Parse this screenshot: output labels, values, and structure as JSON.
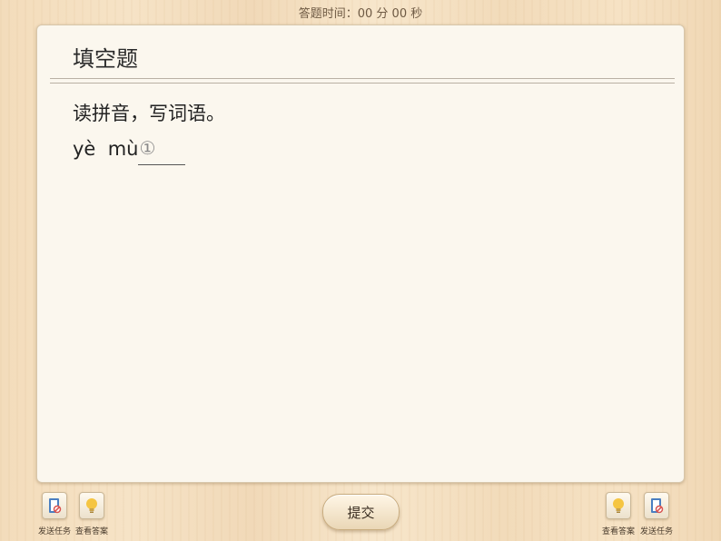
{
  "timer": {
    "text": "答题时间：00 分 00 秒"
  },
  "question": {
    "type_title": "填空题",
    "instruction": "读拼音，写词语。",
    "pinyin": "yè  mù",
    "blank_number": "①"
  },
  "toolbar": {
    "left": [
      {
        "label": "发送任务",
        "icon": "send-task-icon"
      },
      {
        "label": "查看答案",
        "icon": "lightbulb-icon"
      }
    ],
    "right": [
      {
        "label": "查看答案",
        "icon": "lightbulb-icon"
      },
      {
        "label": "发送任务",
        "icon": "send-task-icon"
      }
    ],
    "submit_label": "提交"
  },
  "colors": {
    "card_bg": "#fbf7ee",
    "wood_bg": "#f3dcbb",
    "bulb": "#f5c542",
    "book_blue": "#4a7fc1",
    "stop_red": "#d9534f"
  }
}
